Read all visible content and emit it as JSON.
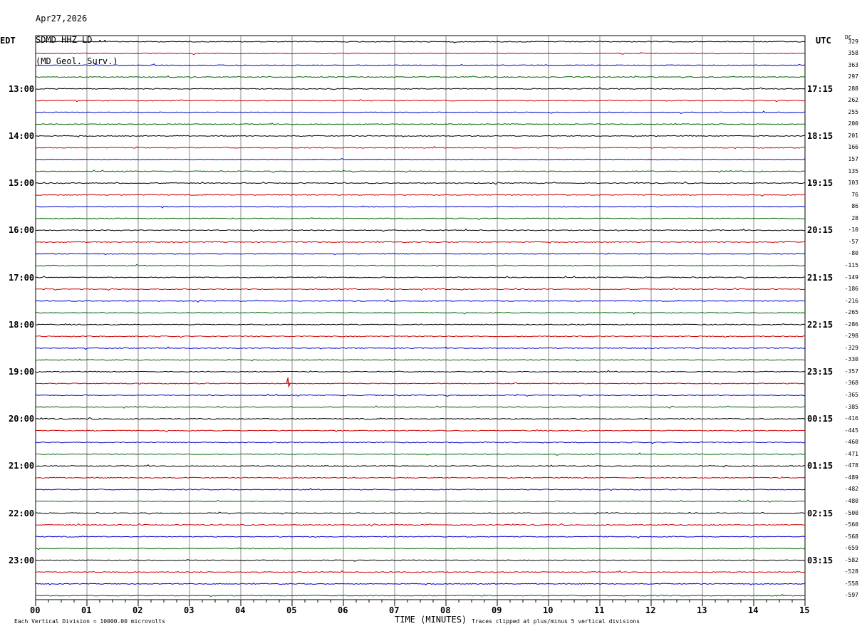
{
  "header": {
    "date": "Apr27,2026",
    "station": "SDMD HHZ LD --",
    "agency": "(MD Geol. Surv.)"
  },
  "left_axis_title": "EDT",
  "right_axis_title": "UTC",
  "dc_title": "DC",
  "footer": {
    "scale_note": "Each Vertical Division = 10000.00 microvolts",
    "x_axis_label": "TIME (MINUTES)",
    "clip_note": "Traces clipped at plus/minus 5 vertical divisions"
  },
  "colors": {
    "trace_colors": [
      "#000000",
      "#cc0000",
      "#0000cc",
      "#006600"
    ],
    "grid": "#888888"
  },
  "chart_data": {
    "type": "line",
    "title": "",
    "xlabel": "TIME (MINUTES)",
    "xlim": [
      0,
      15
    ],
    "x_ticks": [
      "00",
      "01",
      "02",
      "03",
      "04",
      "05",
      "06",
      "07",
      "08",
      "09",
      "10",
      "11",
      "12",
      "13",
      "14",
      "15"
    ],
    "trace_count": 48,
    "minutes_per_trace": 15,
    "left_hour_labels": [
      "13:00",
      "14:00",
      "15:00",
      "16:00",
      "17:00",
      "18:00",
      "19:00",
      "20:00",
      "21:00",
      "22:00",
      "23:00"
    ],
    "right_hour_labels": [
      "17:15",
      "18:15",
      "19:15",
      "20:15",
      "21:15",
      "22:15",
      "23:15",
      "00:15",
      "01:15",
      "02:15",
      "03:15"
    ],
    "hour_label_first_trace": 4,
    "traces_per_hour": 4,
    "dc_offsets": [
      "329",
      "358",
      "363",
      "297",
      "288",
      "262",
      "255",
      "200",
      "201",
      "166",
      "157",
      "135",
      "103",
      "76",
      "86",
      "28",
      "-10",
      "-57",
      "-80",
      "-115",
      "-149",
      "-186",
      "-216",
      "-265",
      "-286",
      "-298",
      "-329",
      "-330",
      "-357",
      "-368",
      "-365",
      "-385",
      "-416",
      "-445",
      "-460",
      "-471",
      "-478",
      "-489",
      "-482",
      "-480",
      "-500",
      "-560",
      "-568",
      "-659",
      "-582",
      "-528",
      "-558",
      "-597"
    ],
    "events": [
      {
        "trace": 29,
        "minute": 4.92,
        "amplitude_divisions": 1.6
      }
    ]
  }
}
